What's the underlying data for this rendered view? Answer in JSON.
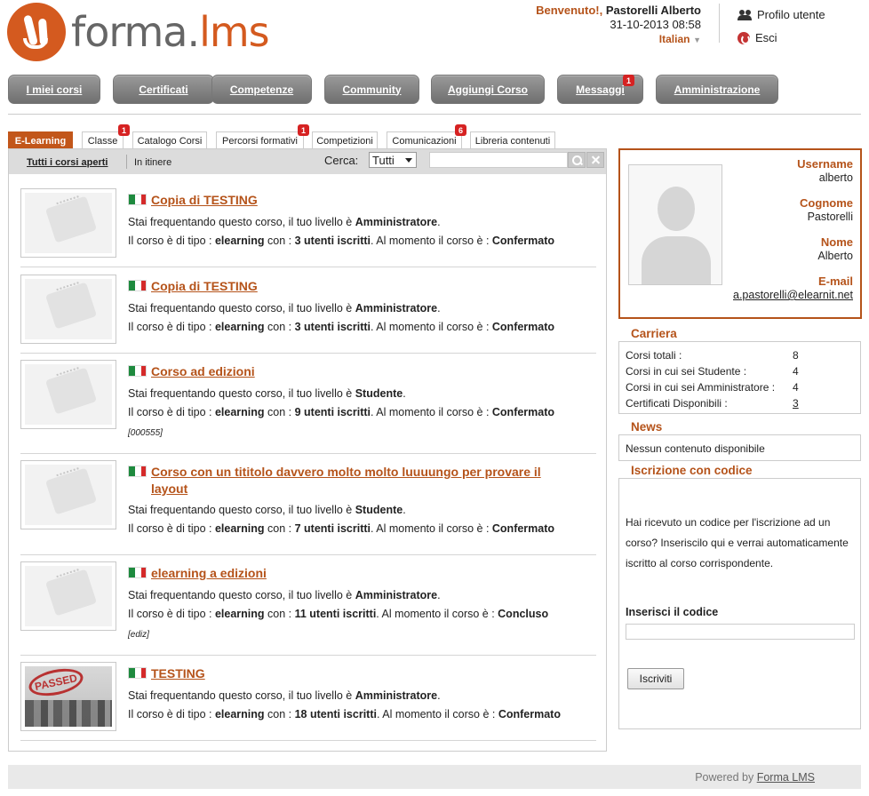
{
  "header": {
    "logo_part1": "forma.",
    "logo_part2": "lms",
    "welcome": "Benvenuto!,",
    "user_name": "Pastorelli Alberto",
    "datetime": "31-10-2013 08:58",
    "language": "Italian",
    "profile_link": "Profilo utente",
    "logout_link": "Esci"
  },
  "nav": [
    {
      "label": "I miei corsi"
    },
    {
      "label": "Certificati"
    },
    {
      "label": "Competenze"
    },
    {
      "label": "Community"
    },
    {
      "label": "Aggiungi Corso"
    },
    {
      "label": "Messaggi",
      "badge": "1"
    },
    {
      "label": "Amministrazione"
    }
  ],
  "tabs": [
    {
      "label": "E-Learning"
    },
    {
      "label": "Classe",
      "badge": "1"
    },
    {
      "label": "Catalogo Corsi"
    },
    {
      "label": "Percorsi formativi",
      "badge": "1"
    },
    {
      "label": "Competizioni"
    },
    {
      "label": "Comunicazioni",
      "badge": "6"
    },
    {
      "label": "Libreria contenuti"
    }
  ],
  "filter": {
    "all_open": "Tutti i corsi aperti",
    "in_progress": "In itinere",
    "search_label": "Cerca:",
    "search_select": "Tutti",
    "search_value": ""
  },
  "text": {
    "line1_prefix": "Stai frequentando questo corso, il tuo livello è ",
    "line2_prefix": "Il corso è di tipo : ",
    "line2_mid": " con : ",
    "line2_suffix": ". Al momento il corso è : "
  },
  "courses": [
    {
      "title": "Copia di TESTING",
      "level": "Amministratore",
      "type": "elearning",
      "users": "3 utenti iscritti",
      "status": "Confermato",
      "code": ""
    },
    {
      "title": "Copia di TESTING",
      "level": "Amministratore",
      "type": "elearning",
      "users": "3 utenti iscritti",
      "status": "Confermato",
      "code": ""
    },
    {
      "title": "Corso ad edizioni",
      "level": "Studente",
      "type": "elearning",
      "users": "9 utenti iscritti",
      "status": "Confermato",
      "code": "[000555]"
    },
    {
      "title": "Corso con un tititolo davvero molto molto luuuungo per provare il layout",
      "level": "Studente",
      "type": "elearning",
      "users": "7 utenti iscritti",
      "status": "Confermato",
      "code": ""
    },
    {
      "title": "elearning a edizioni",
      "level": "Amministratore",
      "type": "elearning",
      "users": "11 utenti iscritti",
      "status": "Concluso",
      "code": "[ediz]"
    },
    {
      "title": "TESTING",
      "level": "Amministratore",
      "type": "elearning",
      "users": "18 utenti iscritti",
      "status": "Confermato",
      "code": "",
      "thumb_stamp": "PASSED"
    }
  ],
  "profile": {
    "username_label": "Username",
    "username": "alberto",
    "surname_label": "Cognome",
    "surname": "Pastorelli",
    "name_label": "Nome",
    "name": "Alberto",
    "email_label": "E-mail",
    "email": "a.pastorelli@elearnit.net"
  },
  "career": {
    "title": "Carriera",
    "rows": [
      {
        "label": "Corsi totali :",
        "value": "8"
      },
      {
        "label": "Corsi in cui sei Studente :",
        "value": "4"
      },
      {
        "label": "Corsi in cui sei Amministratore :",
        "value": "4"
      },
      {
        "label": "Certificati Disponibili :",
        "value": "3"
      }
    ]
  },
  "news": {
    "title": "News",
    "empty": "Nessun contenuto disponibile"
  },
  "code_signup": {
    "title": "Iscrizione con codice",
    "description": "Hai ricevuto un codice per l'iscrizione ad un corso? Inseriscilo qui e verrai automaticamente iscritto al corso corrispondente.",
    "input_label": "Inserisci il codice",
    "input_value": "",
    "button": "Iscriviti"
  },
  "footer": {
    "powered": "Powered by ",
    "brand": "Forma LMS"
  },
  "colors": {
    "accent": "#b5531a",
    "nav_button": "#808080",
    "badge": "#d62222"
  }
}
